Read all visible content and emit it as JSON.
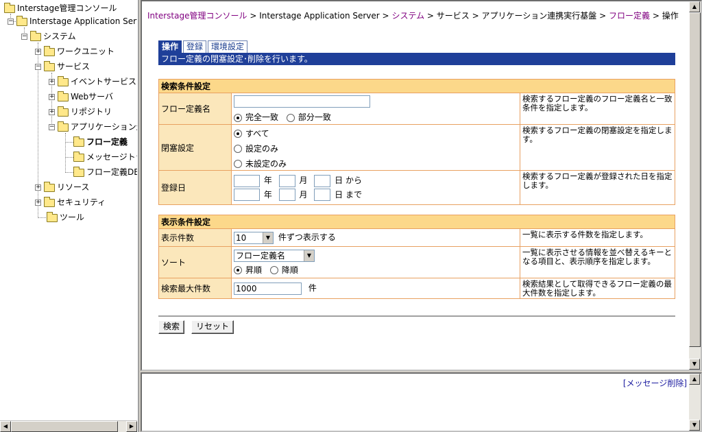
{
  "tree": {
    "root": "Interstage管理コンソール",
    "server": "Interstage Application Server",
    "system": "システム",
    "work_unit": "ワークユニット",
    "service": "サービス",
    "event_service": "イベントサービス",
    "web_server": "Webサーバ",
    "repository": "リポジトリ",
    "app_integration": "アプリケーション連",
    "flow_definition": "フロー定義",
    "message_tracking": "メッセージトラ",
    "flow_definition_db": "フロー定義DB",
    "resource": "リソース",
    "security": "セキュリティ",
    "tool": "ツール"
  },
  "breadcrumb": {
    "items": [
      "Interstage管理コンソール",
      "Interstage Application Server",
      "システム",
      "サービス",
      "アプリケーション連携実行基盤",
      "フロー定義",
      "操作"
    ],
    "separator": ">"
  },
  "tabs": [
    "操作",
    "登録",
    "環境設定"
  ],
  "description": "フロー定義の閉塞設定･削除を行います。",
  "search_section": {
    "title": "検索条件設定",
    "name_row": {
      "label": "フロー定義名",
      "value": "",
      "match_exact": "完全一致",
      "match_partial": "部分一致",
      "help": "検索するフロー定義のフロー定義名と一致条件を指定します。"
    },
    "block_row": {
      "label": "閉塞設定",
      "option_all": "すべて",
      "option_set": "設定のみ",
      "option_unset": "未設定のみ",
      "help": "検索するフロー定義の閉塞設定を指定します。"
    },
    "date_row": {
      "label": "登録日",
      "year": "年",
      "month": "月",
      "day_from": "日 から",
      "day_to": "日 まで",
      "help": "検索するフロー定義が登録された日を指定します。"
    }
  },
  "display_section": {
    "title": "表示条件設定",
    "count_row": {
      "label": "表示件数",
      "selected": "10",
      "suffix": "件ずつ表示する",
      "help": "一覧に表示する件数を指定します。"
    },
    "sort_row": {
      "label": "ソート",
      "selected": "フロー定義名",
      "asc": "昇順",
      "desc": "降順",
      "help": "一覧に表示させる情報を並べ替えるキーとなる項目と、表示順序を指定します。"
    },
    "max_row": {
      "label": "検索最大件数",
      "value": "1000",
      "suffix": "件",
      "help": "検索結果として取得できるフロー定義の最大件数を指定します。"
    }
  },
  "buttons": {
    "search": "検索",
    "reset": "リセット"
  },
  "message_clear": "[メッセージ削除]"
}
